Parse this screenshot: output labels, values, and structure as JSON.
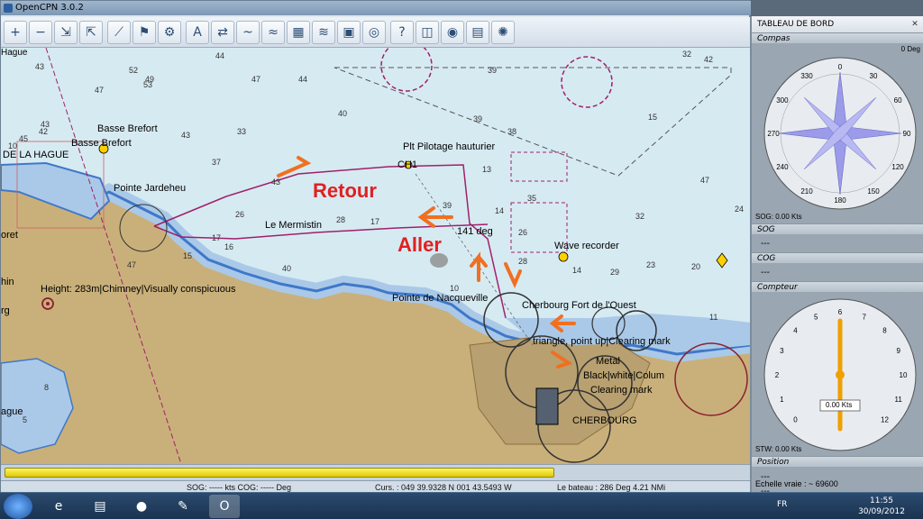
{
  "window": {
    "title": "OpenCPN 3.0.2"
  },
  "toolbar": {
    "buttons": [
      {
        "name": "zoom-in-icon",
        "glyph": "+"
      },
      {
        "name": "zoom-out-icon",
        "glyph": "−"
      },
      {
        "name": "scale-in-icon",
        "glyph": "⇲"
      },
      {
        "name": "scale-out-icon",
        "glyph": "⇱"
      },
      {
        "name": "route-icon",
        "glyph": "⟋"
      },
      {
        "name": "track-icon",
        "glyph": "⚑"
      },
      {
        "name": "settings-icon",
        "glyph": "⚙"
      },
      {
        "name": "text-icon",
        "glyph": "A"
      },
      {
        "name": "auto-follow-icon",
        "glyph": "⇄"
      },
      {
        "name": "current-icon",
        "glyph": "~"
      },
      {
        "name": "tide-icon",
        "glyph": "≈"
      },
      {
        "name": "grib-icon",
        "glyph": "▦"
      },
      {
        "name": "route-manager-icon",
        "glyph": "≋"
      },
      {
        "name": "layer-icon",
        "glyph": "▣"
      },
      {
        "name": "safety-icon",
        "glyph": "◎"
      },
      {
        "name": "help-icon",
        "glyph": "?"
      },
      {
        "name": "dashboard-icon",
        "glyph": "◫"
      },
      {
        "name": "globe-icon",
        "glyph": "◉"
      },
      {
        "name": "photo-icon",
        "glyph": "▤"
      },
      {
        "name": "radar-icon",
        "glyph": "✺"
      }
    ]
  },
  "chart": {
    "labels": {
      "basse_brefort_1": "Basse Brefort",
      "basse_brefort_2": "Basse Brefort",
      "la_hague": "DE LA HAGUE",
      "pointe_jardeheu": "Pointe Jardeheu",
      "plt_pilotage": "Plt Pilotage hauturier",
      "ch1": "CH1",
      "le_mermistin": "Le Mermistin",
      "heading": "141 deg",
      "wave_recorder": "Wave recorder",
      "chimney": "Height: 283m|Chimney|Visually conspicuous",
      "pointe_nacqueville": "Pointe de Nacqueville",
      "cherbourg_fort": "Cherbourg Fort de l'Ouest",
      "triangle": "triangle, point up|Clearing mark",
      "metal": "Metal",
      "black_white": "Black|white|Colum",
      "clearing_mark": "Clearing mark",
      "cherbourg": "CHERBOURG",
      "oret": "oret",
      "hin": "hin",
      "rg": "rg",
      "ague": "ague",
      "hague_top": "Hague"
    },
    "annotations": {
      "retour": "Retour",
      "aller": "Aller"
    },
    "depths": [
      "43",
      "52",
      "44",
      "44",
      "47",
      "53",
      "43",
      "45",
      "10",
      "42",
      "47",
      "43",
      "40",
      "39",
      "32",
      "42",
      "47",
      "43",
      "37",
      "26",
      "28",
      "17",
      "35",
      "26",
      "39",
      "32",
      "14",
      "29",
      "23",
      "20",
      "17",
      "15",
      "49",
      "33",
      "16",
      "40",
      "47",
      "24",
      "11",
      "39",
      "38",
      "15",
      "13",
      "14",
      "28",
      "10",
      "8",
      "5"
    ]
  },
  "progress": {
    "fraction": 0.6
  },
  "status": {
    "sog": "SOG: ----- kts  COG: ----- Deg",
    "cursor": "Curs. : 049 39.9328 N 001 43.5493 W",
    "boat": "Le bateau : 286 Deg    4.21 NMi",
    "scale": "Echelle vraie :  ~ 69600"
  },
  "dashboard": {
    "title": "TABLEAU DE BORD",
    "compass_head": "Compas",
    "compass_readout": "0 Deg",
    "compass_sog": "SOG: 0.00 Kts",
    "sog_head": "SOG",
    "sog_value": "---",
    "cog_head": "COG",
    "cog_value": "---",
    "log_head": "Compteur",
    "log_readout": "0.00 Kts",
    "log_stw": "STW: 0.00 Kts",
    "position_head": "Position",
    "position_lat": "---",
    "position_lon": "---",
    "compass_ticks": [
      "0",
      "30",
      "60",
      "90",
      "120",
      "150",
      "180",
      "210",
      "240",
      "270",
      "300",
      "330"
    ],
    "log_ticks": [
      "0",
      "1",
      "2",
      "3",
      "4",
      "5",
      "6",
      "7",
      "8",
      "9",
      "10",
      "11",
      "12"
    ],
    "log_needle_value": 6
  },
  "taskbar": {
    "lang": "FR",
    "time": "11:55",
    "date": "30/09/2012",
    "apps": [
      {
        "name": "internet-explorer-icon",
        "glyph": "e"
      },
      {
        "name": "file-explorer-icon",
        "glyph": "▤"
      },
      {
        "name": "media-player-icon",
        "glyph": "●"
      },
      {
        "name": "paint-icon",
        "glyph": "✎"
      },
      {
        "name": "opencpn-icon",
        "glyph": "O"
      }
    ]
  },
  "colors": {
    "sea_shallow": "#aac9e8",
    "sea_deep": "#d6eaf2",
    "land": "#c9b07a",
    "land_urban": "#b8a070",
    "coast_blue": "#3f78c9",
    "route": "#a0206a",
    "annotation": "#e02020",
    "arrow": "#f07020"
  }
}
